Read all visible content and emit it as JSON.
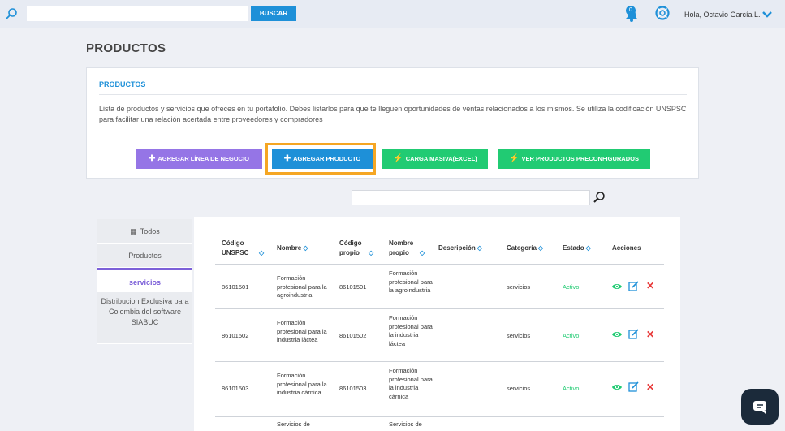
{
  "topbar": {
    "search_value": "",
    "buscar_label": "BUSCAR",
    "notification_count": "0",
    "user_greeting": "Hola, Octavio García L."
  },
  "page_title": "PRODUCTOS",
  "card": {
    "title": "PRODUCTOS",
    "description": "Lista de productos y servicios que ofreces en tu portafolio. Debes listarlos para que te lleguen oportunidades de ventas relacionados a los mismos. Se utiliza la codificación UNSPSC para facilitar una relación acertada entre proveedores y compradores",
    "buttons": {
      "linea": "AGREGAR LÍNEA DE NEGOCIO",
      "producto": "AGREGAR PRODUCTO",
      "carga": "CARGA MASIVA(EXCEL)",
      "ver": "VER PRODUCTOS PRECONFIGURADOS"
    }
  },
  "mid_search_value": "",
  "sidebar": {
    "todos": "Todos",
    "productos": "Productos",
    "servicios": "servicios",
    "distrib": "Distribucion Exclusiva para Colombia del software SIABUC"
  },
  "table": {
    "headers": {
      "codigo": "Código UNSPSC",
      "nombre": "Nombre",
      "codigo_propio": "Código propio",
      "nombre_propio": "Nombre propio",
      "descripcion": "Descripción",
      "categoria": "Categoría",
      "estado": "Estado",
      "acciones": "Acciones"
    },
    "rows": [
      {
        "codigo": "86101501",
        "nombre": "Formación profesional para la agroindustria",
        "codigo_propio": "86101501",
        "nombre_propio": "Formación profesional para la agroindustria",
        "descripcion": "",
        "categoria": "servicios",
        "estado": "Activo"
      },
      {
        "codigo": "86101502",
        "nombre": "Formación profesional para la industria láctea",
        "codigo_propio": "86101502",
        "nombre_propio": "Formación profesional para la industria láctea",
        "descripcion": "",
        "categoria": "servicios",
        "estado": "Activo"
      },
      {
        "codigo": "86101503",
        "nombre": "Formación profesional para la industria cárnica",
        "codigo_propio": "86101503",
        "nombre_propio": "Formación profesional para la industria cárnica",
        "descripcion": "",
        "categoria": "servicios",
        "estado": "Activo"
      },
      {
        "codigo": "",
        "nombre": "Servicios de",
        "codigo_propio": "",
        "nombre_propio": "Servicios de",
        "descripcion": "",
        "categoria": "",
        "estado": ""
      }
    ]
  },
  "colors": {
    "accent_blue": "#1e90d8",
    "purple": "#9575e6",
    "green": "#21cb73",
    "highlight_orange": "#f5a623",
    "delete_red": "#e83a3a"
  }
}
